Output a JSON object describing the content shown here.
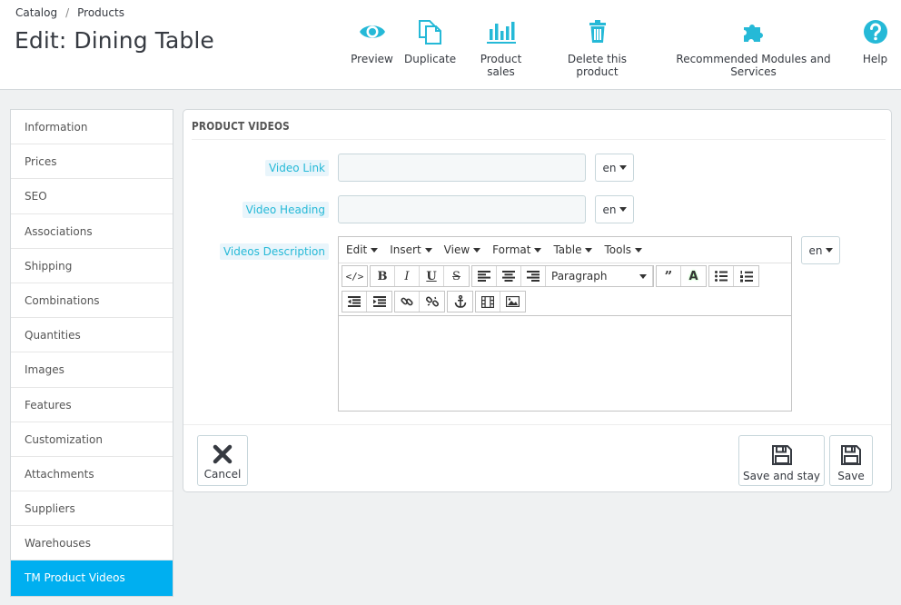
{
  "breadcrumb": {
    "parent": "Catalog",
    "separator": "/",
    "current": "Products"
  },
  "page_title": "Edit: Dining Table",
  "toolbar": {
    "preview": "Preview",
    "duplicate": "Duplicate",
    "product_sales": "Product sales",
    "delete": "Delete this product",
    "modules": "Recommended Modules and Services",
    "help": "Help"
  },
  "sidebar": {
    "items": [
      {
        "label": "Information"
      },
      {
        "label": "Prices"
      },
      {
        "label": "SEO"
      },
      {
        "label": "Associations"
      },
      {
        "label": "Shipping"
      },
      {
        "label": "Combinations"
      },
      {
        "label": "Quantities"
      },
      {
        "label": "Images"
      },
      {
        "label": "Features"
      },
      {
        "label": "Customization"
      },
      {
        "label": "Attachments"
      },
      {
        "label": "Suppliers"
      },
      {
        "label": "Warehouses"
      },
      {
        "label": "TM Product Videos"
      }
    ],
    "active_index": 13
  },
  "panel": {
    "heading": "PRODUCT VIDEOS",
    "video_link": {
      "label": "Video Link",
      "value": "",
      "lang": "en"
    },
    "video_heading": {
      "label": "Video Heading",
      "value": "",
      "lang": "en"
    },
    "videos_description": {
      "label": "Videos Description",
      "lang": "en"
    }
  },
  "editor": {
    "menus": [
      "Edit",
      "Insert",
      "View",
      "Format",
      "Table",
      "Tools"
    ],
    "block_format": "Paragraph"
  },
  "footer": {
    "cancel": "Cancel",
    "save_and_stay": "Save and stay",
    "save": "Save"
  },
  "colors": {
    "accent": "#25b9d7",
    "active": "#00aff0",
    "background": "#eff1f2"
  }
}
